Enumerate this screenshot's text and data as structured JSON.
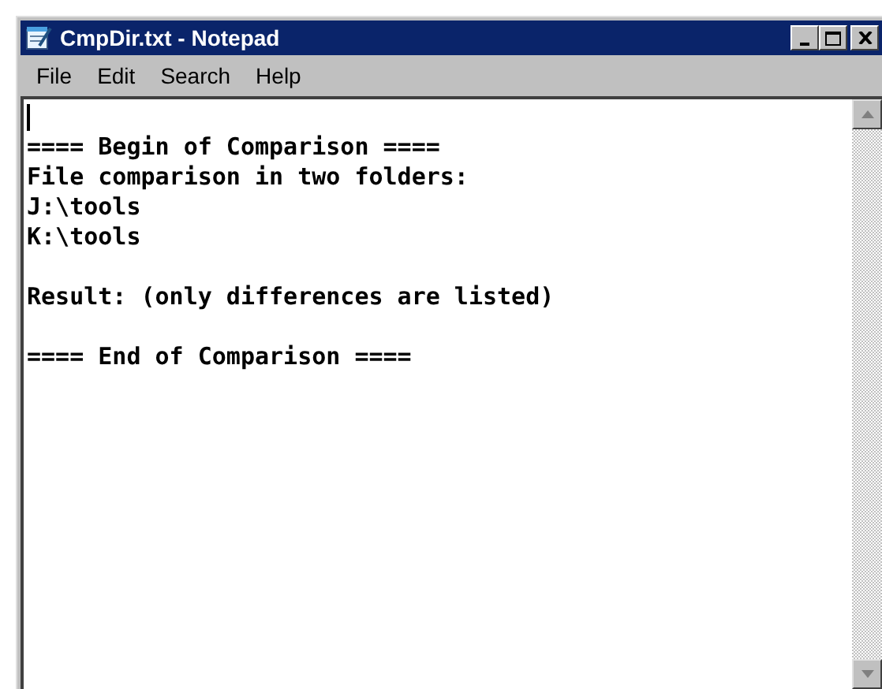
{
  "window": {
    "title": "CmpDir.txt - Notepad"
  },
  "menu": [
    {
      "label": "File"
    },
    {
      "label": "Edit"
    },
    {
      "label": "Search"
    },
    {
      "label": "Help"
    }
  ],
  "document": {
    "lines": [
      {
        "kind": "caret"
      },
      {
        "kind": "text",
        "text": "==== Begin of Comparison ===="
      },
      {
        "kind": "text",
        "text": "File comparison in two folders:"
      },
      {
        "kind": "text",
        "text": "J:\\tools"
      },
      {
        "kind": "text",
        "text": "K:\\tools"
      },
      {
        "kind": "blank"
      },
      {
        "kind": "text",
        "text": "Result: (only differences are listed)"
      },
      {
        "kind": "blank"
      },
      {
        "kind": "text",
        "text": "==== End of Comparison ===="
      }
    ]
  }
}
